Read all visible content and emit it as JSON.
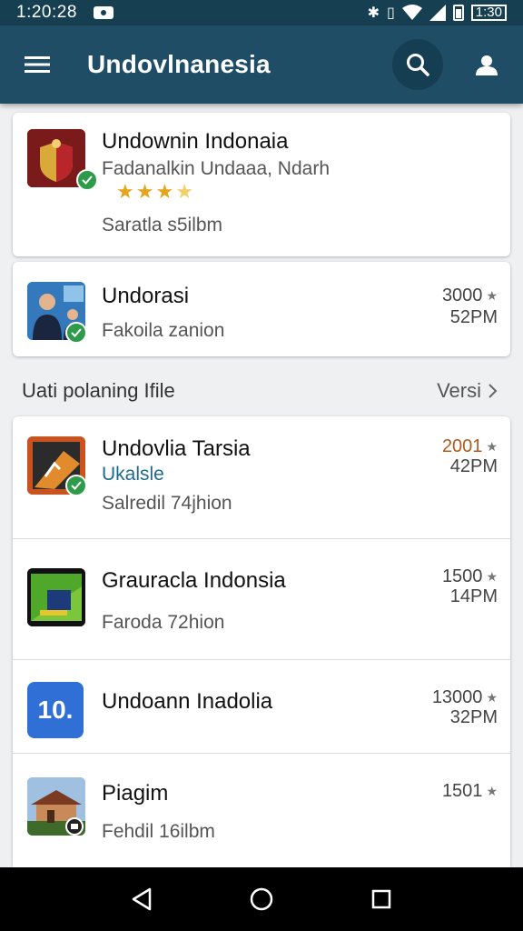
{
  "status": {
    "time": "1:20:28",
    "battery_text": "1:30"
  },
  "appbar": {
    "title": "Undovlnanesia",
    "menu_icon": "menu-icon",
    "search_icon": "search-icon",
    "account_icon": "account-icon"
  },
  "featured": [
    {
      "title": "Undownin Indonaia",
      "subtitle": "Fadanalkin Undaaa, Ndarh",
      "rating": 3.5,
      "meta": "Saratla s5ilbm"
    },
    {
      "title": "Undorasi",
      "subtitle": "Fakoila zanion",
      "count": "3000",
      "time": "52PM"
    }
  ],
  "section": {
    "title": "Uati polaning Ifile",
    "action": "Versi"
  },
  "list": [
    {
      "title": "Undovlia Tarsia",
      "subtitle": "Ukalsle",
      "meta": "Salredil 74jhion",
      "count": "2001",
      "time": "42PM"
    },
    {
      "title": "Grauracla Indonsia",
      "meta": "Faroda 72hion",
      "count": "1500",
      "time": "14PM"
    },
    {
      "title": "Undoann Inadolia",
      "icon_text": "10.",
      "count": "13000",
      "time": "32PM"
    },
    {
      "title": "Piagim",
      "meta": "Fehdil 16ilbm",
      "count": "1501"
    }
  ],
  "colors": {
    "appbar": "#1f4d66",
    "statusbar": "#173f52",
    "accent_orange": "#b35a1a",
    "accent_blue": "#1d6b8f",
    "badge_green": "#2e9b4a"
  }
}
